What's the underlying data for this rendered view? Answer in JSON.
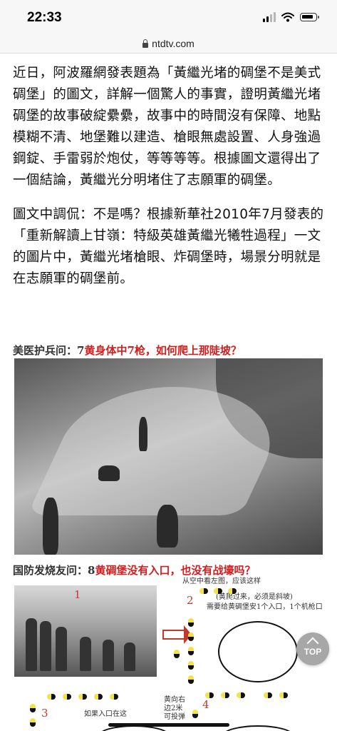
{
  "status_bar": {
    "time": "22:33"
  },
  "browser": {
    "url": "ntdtv.com"
  },
  "article": {
    "paragraphs": [
      "近日，阿波羅網發表題為「黃繼光堵的碉堡不是美式碉堡」的圖文，詳解一個驚人的事實，證明黃繼光堵碉堡的故事破綻纍纍，故事中的時間沒有保障、地點模糊不清、地堡難以建造、槍眼無處設置、人身強過鋼錠、手雷弱於炮仗，等等等等。根據圖文還得出了一個結論，黃繼光分明堵住了志願軍的碉堡。",
      "圖文中調侃：不是嗎？根據新華社2010年7月發表的「重新解讀上甘嶺：特級英雄黃繼光犧牲過程」一文的圖片中，黃繼光堵槍眼、炸碉堡時，場景分明就是在志願軍的碉堡前。"
    ]
  },
  "figure": {
    "caption1_black": "美医护兵问：7",
    "caption1_red": "黄身体中7枪，如何爬上那陡坡？",
    "caption2_black": "国防发烧友问：8",
    "caption2_red": "黄碉堡没有入口，也没有战壕吗？",
    "marker1": "1",
    "marker2": "2",
    "marker3": "3",
    "marker4": "4",
    "note_top": "从空中看左图，应该这样",
    "note_mid1": "(黄爬过来，必须是斜坡)",
    "note_mid2": "需要给黄碉堡安1个入口，1个机枪口",
    "note_bottom1": "黄向右",
    "note_bottom2": "边2米",
    "note_bottom3": "可投弹",
    "note_bottom4": "如果入口在这"
  },
  "controls": {
    "back_to_top": "TOP"
  },
  "colors": {
    "caption_red": "#d31d1d",
    "pill_yellow": "#f2e24b"
  }
}
